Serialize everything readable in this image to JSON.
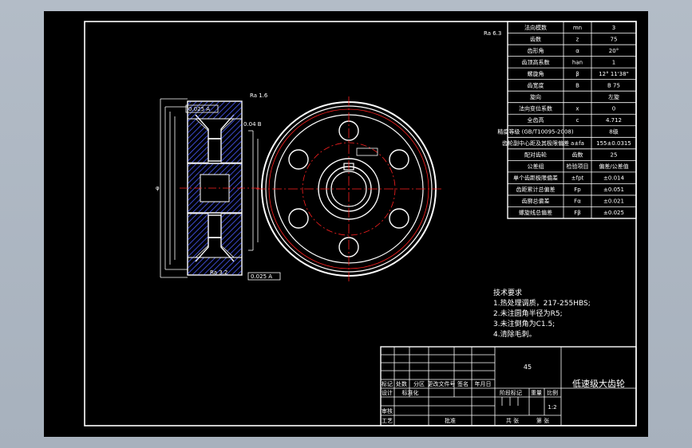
{
  "gear_table": {
    "rows": [
      {
        "name": "法向模数",
        "symbol": "mn",
        "value": "3"
      },
      {
        "name": "齿数",
        "symbol": "z",
        "value": "75"
      },
      {
        "name": "齿形角",
        "symbol": "α",
        "value": "20°"
      },
      {
        "name": "齿顶高系数",
        "symbol": "han",
        "value": "1"
      },
      {
        "name": "螺旋角",
        "symbol": "β",
        "value": "12° 11'38\""
      },
      {
        "name": "齿宽度",
        "symbol": "B",
        "value": "B 75"
      },
      {
        "name": "旋向",
        "symbol": "",
        "value": "左旋"
      },
      {
        "name": "法向变位系数",
        "symbol": "x",
        "value": "0"
      },
      {
        "name": "全齿高",
        "symbol": "c",
        "value": "4.712"
      },
      {
        "name": "精度等级 (GB/T10095-2008)",
        "symbol": "",
        "value": "8级"
      },
      {
        "name": "齿轮副中心距及其极限偏差",
        "symbol": "a±fa",
        "value": "155±0.0315"
      },
      {
        "name": "配对齿轮",
        "symbol": "齿数",
        "value": "25"
      },
      {
        "name": "公差组",
        "symbol": "检验项目",
        "value": "偏差/公差值"
      },
      {
        "name": "单个齿距极限偏差",
        "symbol": "±fpt",
        "value": "±0.014"
      },
      {
        "name": "齿距累计总偏差",
        "symbol": "Fp",
        "value": "±0.051"
      },
      {
        "name": "齿廓总偏差",
        "symbol": "Fα",
        "value": "±0.021"
      },
      {
        "name": "螺旋线总偏差",
        "symbol": "Fβ",
        "value": "±0.025"
      }
    ],
    "corner_roughness": "Ra 6.3"
  },
  "tech_req": {
    "title": "技术要求",
    "items": [
      "1.热处理调质，217-255HBS;",
      "2.未注圆角半径为R5;",
      "3.未注倒角为C1.5;",
      "4.清除毛刺。"
    ]
  },
  "title_block": {
    "part_name": "低速级大齿轮",
    "material": "45",
    "scale": "1:2",
    "labels": [
      "标记",
      "处数",
      "分区",
      "更改文件号",
      "签名",
      "年月日",
      "设计",
      "标准化",
      "阶段标记",
      "重量",
      "比例",
      "审核",
      "工艺",
      "批准",
      "共 张",
      "第 张"
    ]
  },
  "annotations": {
    "tol_top": "0.025 A",
    "tol_bottom": "0.025 A",
    "tol_hub": "0.04 B",
    "roughness_face": "Ra 1.6",
    "roughness_bore": "Ra 3.2",
    "dim_label": "φ"
  },
  "colors": {
    "background": "#000000",
    "lines": "#ffffff",
    "centerline": "#ff2020",
    "hatch": "#4a5cff",
    "frame_outer": "#a9b2be"
  }
}
